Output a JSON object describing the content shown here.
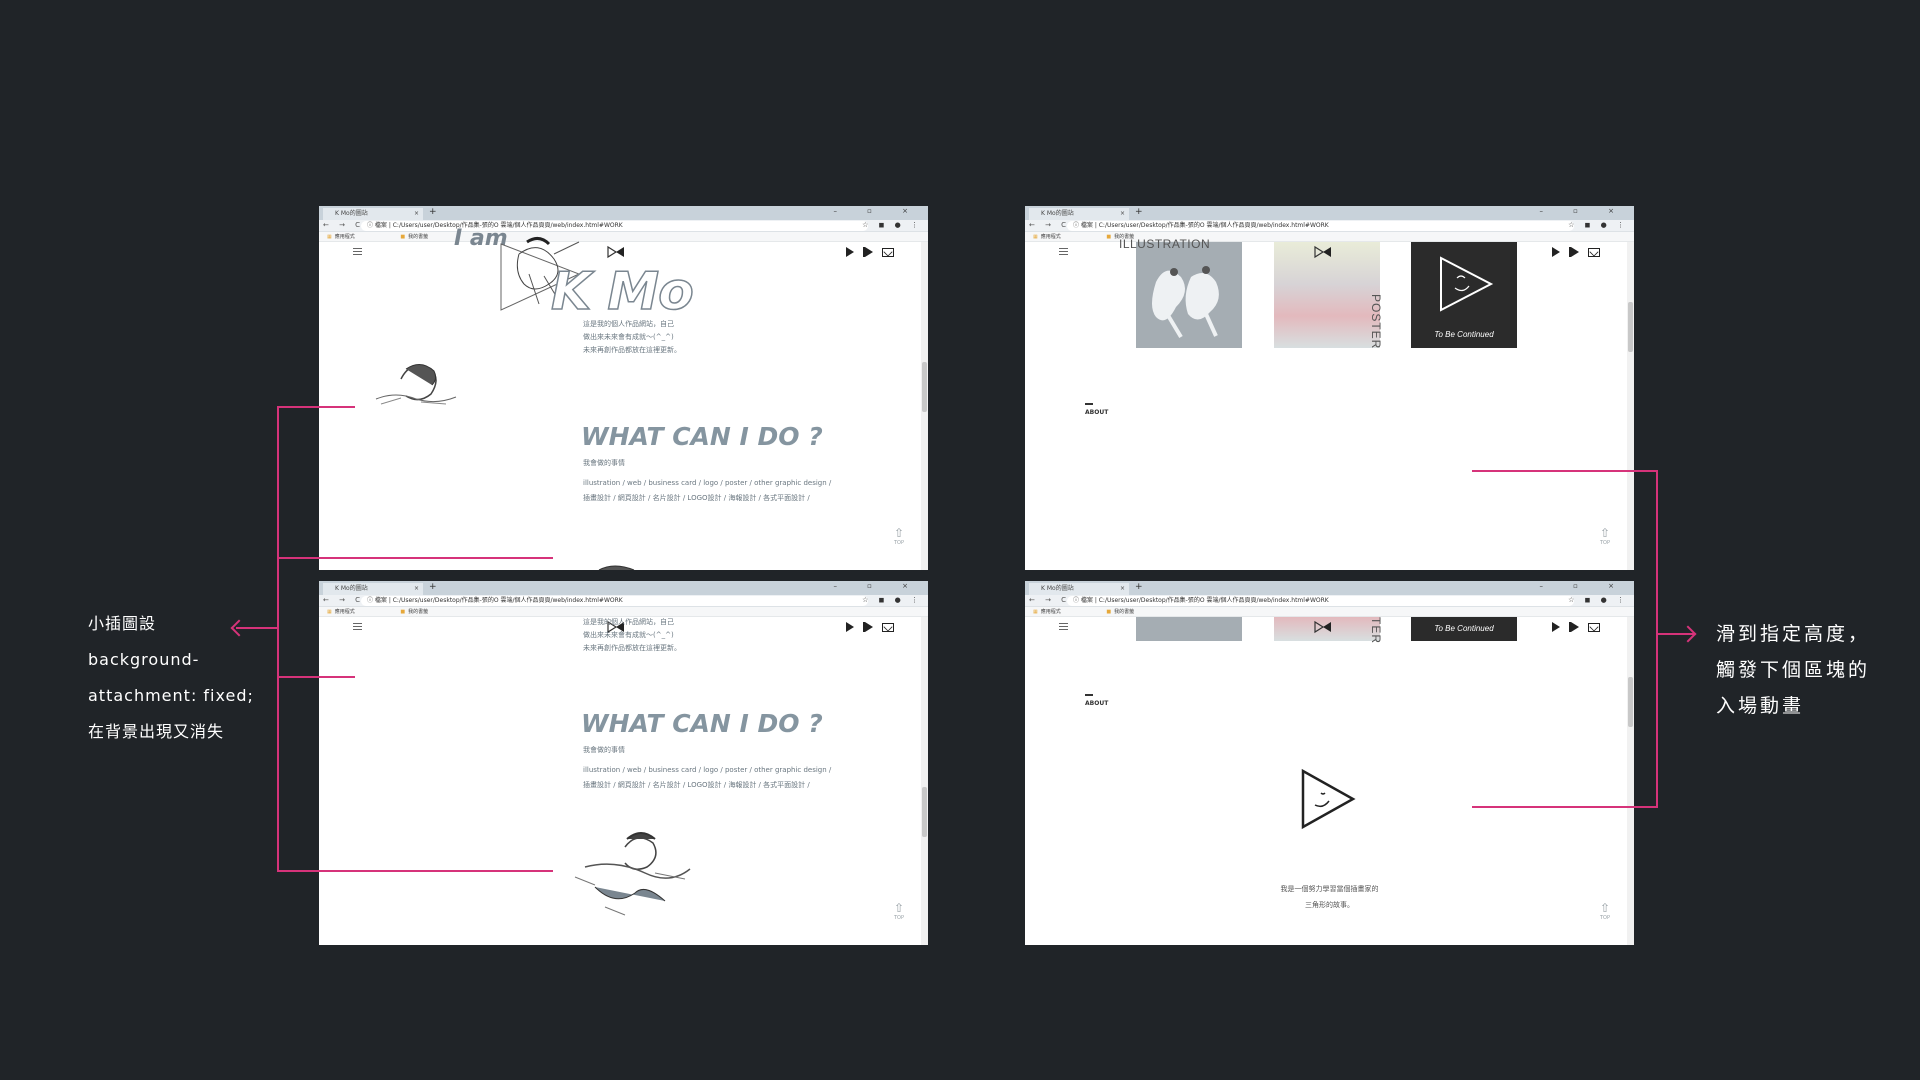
{
  "browser": {
    "tab_title": "K Mo的圖站",
    "tab_close": "×",
    "new_tab": "+",
    "window_controls": "– ▫ ×",
    "nav_buttons": "← → C",
    "url": "ⓘ 檔案 | C:/Users/user/Desktop/作品集-張的O 雲端/個人作品頁頁/web/index.html#WORK",
    "addr_icons": "☆ ◼ ● ⋮",
    "bookmarks": [
      "應用程式",
      "我的書籤"
    ]
  },
  "shot1": {
    "i_am": "I am",
    "name": "K Mo",
    "intro": [
      "這是我的個人作品網站，自己",
      "做出來未來會有成就～(^_^)",
      "未來再創作品都放在這裡更新。"
    ],
    "what_title": "WHAT CAN I DO ?",
    "what_sub": "我會做的事情",
    "what_desc": [
      "illustration / web / business card / logo / poster / other graphic design /",
      "插畫設計 / 網頁設計 / 名片設計 / LOGO設計 / 海報設計 / 各式平面設計 /"
    ]
  },
  "shot2": {
    "intro": [
      "這是我的個人作品網站，自己",
      "做出來未來會有成就～(^_^)",
      "未來再創作品都放在這裡更新。"
    ],
    "what_title": "WHAT CAN I DO ?",
    "what_sub": "我會做的事情",
    "what_desc": [
      "illustration / web / business card / logo / poster / other graphic design /",
      "插畫設計 / 網頁設計 / 名片設計 / LOGO設計 / 海報設計 / 各式平面設計 /"
    ]
  },
  "shot3": {
    "illustration_label": "ILLUSTRATION",
    "poster_label": "POSTER",
    "tbc": "To Be Continued",
    "about": "ABOUT"
  },
  "shot4": {
    "poster_label": "TER",
    "tbc": "To Be Continued",
    "about": "ABOUT",
    "bottom_text": [
      "我是一個努力學習當個插畫家的",
      "三角形的故事。"
    ]
  },
  "common": {
    "top_label": "TOP"
  },
  "annotations": {
    "left": [
      "小插圖設",
      "background-",
      "attachment: fixed;",
      "在背景出現又消失"
    ],
    "right": [
      "滑到指定高度，",
      "觸發下個區塊的",
      "入場動畫"
    ]
  },
  "colors": {
    "background": "#202428",
    "accent": "#d6337a",
    "title": "#8595a0"
  }
}
